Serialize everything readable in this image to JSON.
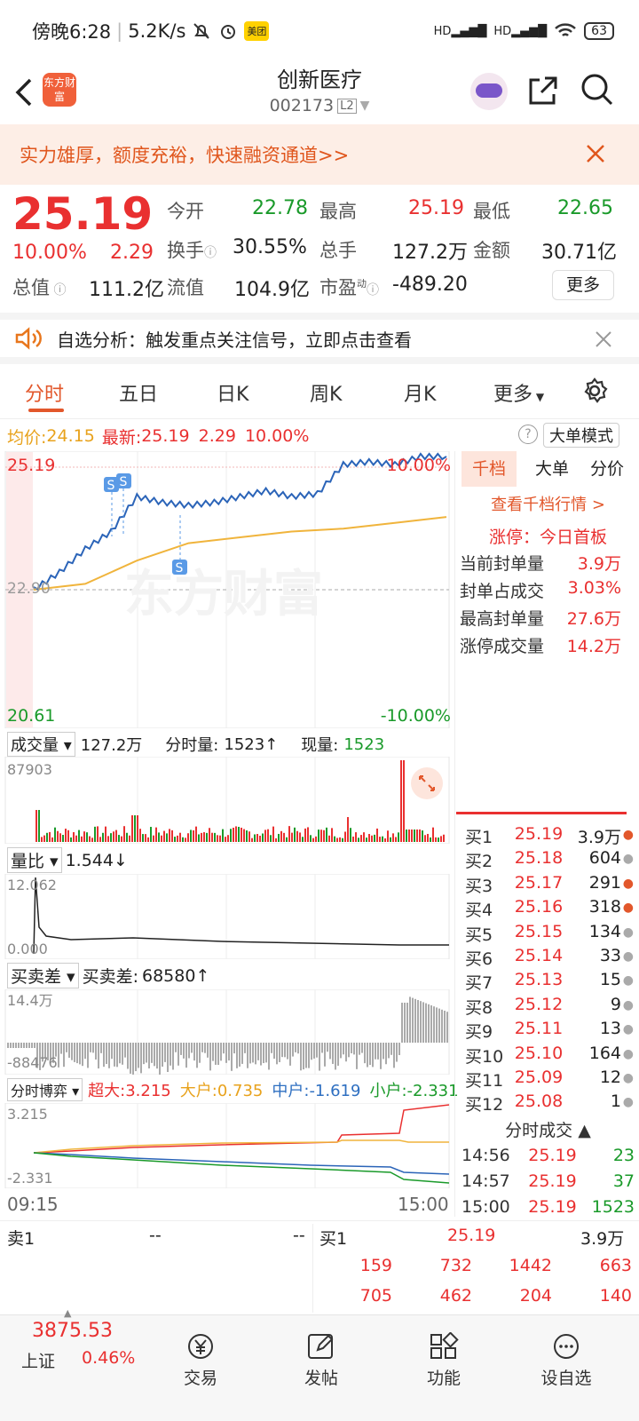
{
  "status_bar": {
    "time": "傍晚6:28",
    "speed": "5.2K/s",
    "app_badge": "美团",
    "battery": "63"
  },
  "header": {
    "title": "创新医疗",
    "code": "002173",
    "level": "L2",
    "back_icon": "chevron-left-icon",
    "logo": "东方财富"
  },
  "banner": {
    "text": "实力雄厚，额度充裕，快速融资通道>>"
  },
  "quote": {
    "price": "25.19",
    "pct": "10.00%",
    "change": "2.29",
    "open_label": "今开",
    "open": "22.78",
    "high_label": "最高",
    "high": "25.19",
    "low_label": "最低",
    "low": "22.65",
    "turnover_label": "换手",
    "turnover": "30.55%",
    "volume_label": "总手",
    "volume": "127.2万",
    "amount_label": "金额",
    "amount": "30.71亿",
    "mcap_label": "总值",
    "mcap": "111.2亿",
    "float_label": "流值",
    "float": "104.9亿",
    "pe_label": "市盈",
    "pe_sup": "动",
    "pe": "-489.20",
    "more": "更多"
  },
  "notice": {
    "text": "自选分析：触发重点关注信号，立即点击查看"
  },
  "tabs": [
    "分时",
    "五日",
    "日K",
    "周K",
    "月K",
    "更多"
  ],
  "info": {
    "avg_label": "均价:",
    "avg": "24.15",
    "latest_label": "最新:",
    "latest": "25.19",
    "chg": "2.29",
    "pct": "10.00%",
    "mode": "大单模式"
  },
  "chart": {
    "high_label": "25.19",
    "low_label": "20.61",
    "mid_label": "22.90",
    "up_pct": "10.00%",
    "down_pct": "-10.00%",
    "watermark": "东方财富",
    "marker": "S",
    "colors": {
      "price": "#2b64b8",
      "avg": "#f0b43c",
      "up": "#e93030",
      "down": "#1a9a2a"
    }
  },
  "chart_data": [
    {
      "type": "line",
      "title": "分时",
      "series": [
        {
          "name": "最新",
          "x": [
            "09:30",
            "09:45",
            "10:00",
            "10:15",
            "10:30",
            "10:45",
            "11:00",
            "11:15",
            "11:30",
            "13:15",
            "13:30",
            "13:45",
            "14:00",
            "14:15",
            "14:30",
            "14:45",
            "15:00"
          ],
          "values": [
            22.9,
            23.2,
            23.6,
            23.9,
            24.5,
            24.4,
            24.35,
            24.4,
            24.5,
            24.6,
            24.5,
            24.55,
            25.05,
            25.1,
            25.05,
            25.19,
            25.19
          ]
        },
        {
          "name": "均价",
          "x": [
            "09:30",
            "10:00",
            "10:30",
            "11:00",
            "11:30",
            "13:30",
            "14:00",
            "14:30",
            "15:00"
          ],
          "values": [
            22.9,
            23.0,
            23.4,
            23.7,
            23.8,
            23.9,
            23.95,
            24.05,
            24.15
          ]
        }
      ],
      "ylim": [
        20.61,
        25.19
      ],
      "xlabel": "",
      "ylabel": ""
    }
  ],
  "vol": {
    "label": "成交量",
    "total": "127.2万",
    "fs_label": "分时量:",
    "fs": "1523↑",
    "now_label": "现量:",
    "now": "1523",
    "max": "87903"
  },
  "qb": {
    "label": "量比",
    "value": "1.544↓",
    "max": "12.062",
    "min": "0.000"
  },
  "mmc": {
    "label": "买卖差",
    "val_label": "买卖差:",
    "value": "68580↑",
    "max": "14.4万",
    "min": "-88476"
  },
  "bo": {
    "label": "分时博弈",
    "super_label": "超大:",
    "super": "3.215",
    "big_label": "大户:",
    "big": "0.735",
    "mid_label": "中户:",
    "mid": "-1.619",
    "small_label": "小户:",
    "small": "-2.331",
    "max": "3.215",
    "min": "-2.331",
    "t_start": "09:15",
    "t_end": "15:00"
  },
  "side": {
    "tabs": [
      "千档",
      "大单",
      "分价"
    ],
    "link": "查看千档行情 >",
    "limit_label": "涨停：",
    "limit": "今日首板",
    "rows": [
      {
        "k": "当前封单量",
        "v": "3.9万"
      },
      {
        "k": "封单占成交",
        "v": "3.03%"
      },
      {
        "k": "最高封单量",
        "v": "27.6万"
      },
      {
        "k": "涨停成交量",
        "v": "14.2万"
      }
    ],
    "bids": [
      {
        "l": "买1",
        "p": "25.19",
        "v": "3.9万",
        "dot": "red"
      },
      {
        "l": "买2",
        "p": "25.18",
        "v": "604",
        "dot": "grey"
      },
      {
        "l": "买3",
        "p": "25.17",
        "v": "291",
        "dot": "red"
      },
      {
        "l": "买4",
        "p": "25.16",
        "v": "318",
        "dot": "red"
      },
      {
        "l": "买5",
        "p": "25.15",
        "v": "134",
        "dot": "grey"
      },
      {
        "l": "买6",
        "p": "25.14",
        "v": "33",
        "dot": "grey"
      },
      {
        "l": "买7",
        "p": "25.13",
        "v": "15",
        "dot": "grey"
      },
      {
        "l": "买8",
        "p": "25.12",
        "v": "9",
        "dot": "grey"
      },
      {
        "l": "买9",
        "p": "25.11",
        "v": "13",
        "dot": "grey"
      },
      {
        "l": "买10",
        "p": "25.10",
        "v": "164",
        "dot": "grey"
      },
      {
        "l": "买11",
        "p": "25.09",
        "v": "12",
        "dot": "grey"
      },
      {
        "l": "买12",
        "p": "25.08",
        "v": "1",
        "dot": "grey"
      }
    ],
    "trades_title": "分时成交",
    "trades": [
      {
        "t": "14:56",
        "p": "25.19",
        "v": "23"
      },
      {
        "t": "14:57",
        "p": "25.19",
        "v": "37"
      },
      {
        "t": "15:00",
        "p": "25.19",
        "v": "1523"
      }
    ]
  },
  "bottom_q": {
    "sell_label": "卖1",
    "sell_p": "--",
    "sell_v": "--",
    "buy_label": "买1",
    "buy_p": "25.19",
    "buy_v": "3.9万",
    "r1": [
      "159",
      "732",
      "1442",
      "663"
    ],
    "r2": [
      "705",
      "462",
      "204",
      "140"
    ]
  },
  "bottom_nav": {
    "index": "3875.53",
    "index_name": "上证",
    "index_pct": "0.46%",
    "items": [
      "交易",
      "发帖",
      "功能",
      "设自选"
    ]
  }
}
